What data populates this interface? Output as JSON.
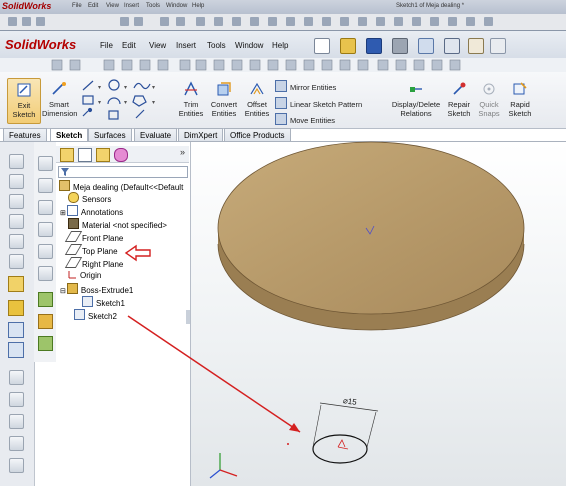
{
  "background_window": {
    "app_name": "SolidWorks",
    "menus": [
      "File",
      "Edit",
      "View",
      "Insert",
      "Tools",
      "Window",
      "Help"
    ],
    "caption": "Sketch1 of Meja dealing *"
  },
  "window": {
    "app_name": "SolidWorks",
    "menus": [
      "File",
      "Edit",
      "View",
      "Insert",
      "Tools",
      "Window",
      "Help"
    ]
  },
  "command_manager": {
    "exit_sketch": "Exit Sketch",
    "smart_dimension": "Smart Dimension",
    "trim_entities": "Trim Entities",
    "convert_entities": "Convert Entities",
    "offset_entities": "Offset Entities",
    "mirror_entities": "Mirror Entities",
    "linear_sketch_pattern": "Linear Sketch Pattern",
    "move_entities": "Move Entities",
    "display_delete_relations": "Display/Delete Relations",
    "repair_sketch": "Repair Sketch",
    "quick_snaps": "Quick Snaps",
    "rapid_sketch": "Rapid Sketch"
  },
  "tabs": [
    "Features",
    "Sketch",
    "Surfaces",
    "Evaluate",
    "DimXpert",
    "Office Products"
  ],
  "active_tab": "Sketch",
  "tree": {
    "root": "Meja dealing  (Default<<Default",
    "items": [
      "Sensors",
      "Annotations",
      "Material <not specified>",
      "Front Plane",
      "Top Plane",
      "Right Plane",
      "Origin",
      "Boss-Extrude1",
      "Sketch1",
      "Sketch2"
    ]
  },
  "sketch": {
    "dimension": "⌀15"
  },
  "colors": {
    "annotation_red": "#d42020",
    "disk_wood": "#b79a6a"
  }
}
